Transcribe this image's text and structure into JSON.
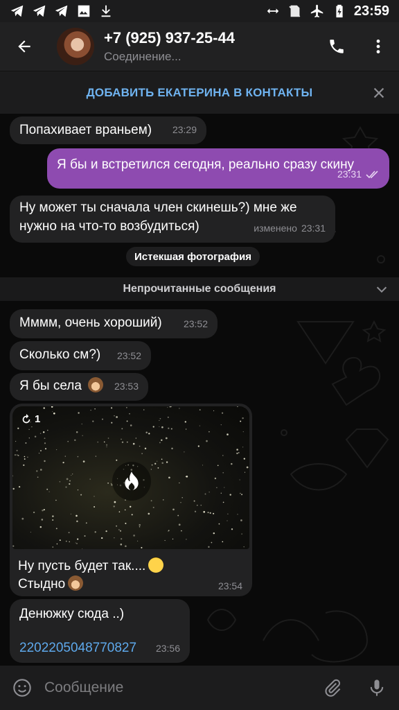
{
  "status_bar": {
    "time": "23:59",
    "left_icons": [
      "telegram-icon",
      "telegram-icon",
      "telegram-icon",
      "image-icon",
      "download-icon"
    ],
    "right_icons": [
      "data-saver-icon",
      "no-sim-icon",
      "airplane-icon",
      "battery-charging-icon"
    ]
  },
  "header": {
    "title": "+7 (925) 937-25-44",
    "subtitle": "Соединение..."
  },
  "banner": {
    "text": "ДОБАВИТЬ ЕКАТЕРИНА В КОНТАКТЫ"
  },
  "messages": [
    {
      "dir": "in",
      "text": "Попахивает враньем)",
      "time": "23:29"
    },
    {
      "dir": "out",
      "text": "Я бы и встретился сегодня, реально сразу скину",
      "time": "23:31"
    },
    {
      "dir": "in",
      "line1": "Ну может ты сначала член скинешь?) мне же",
      "line2": "нужно на что-то возбудиться)",
      "edited": "изменено",
      "time": "23:31"
    },
    {
      "dir": "in",
      "text": "Мммм, очень хороший)",
      "time": "23:52"
    },
    {
      "dir": "in",
      "text": "Сколько см?)",
      "time": "23:52"
    },
    {
      "dir": "in",
      "text": "Я бы села",
      "time": "23:53"
    },
    {
      "dir": "in",
      "counter": "1",
      "caption_line1": "Ну пусть будет так....",
      "caption_line2": "Стыдно",
      "time": "23:54"
    },
    {
      "dir": "in",
      "line1": "Денюжку сюда ..)",
      "link": "2202205048770827",
      "time": "23:56"
    }
  ],
  "service": {
    "expired_photo": "Истекшая фотография",
    "unread": "Непрочитанные сообщения"
  },
  "input": {
    "placeholder": "Сообщение"
  },
  "colors": {
    "outgoing_bubble": "#8e4bb0",
    "incoming_bubble": "#222223",
    "link": "#5ea9ec",
    "banner_text": "#6fb3f0"
  }
}
